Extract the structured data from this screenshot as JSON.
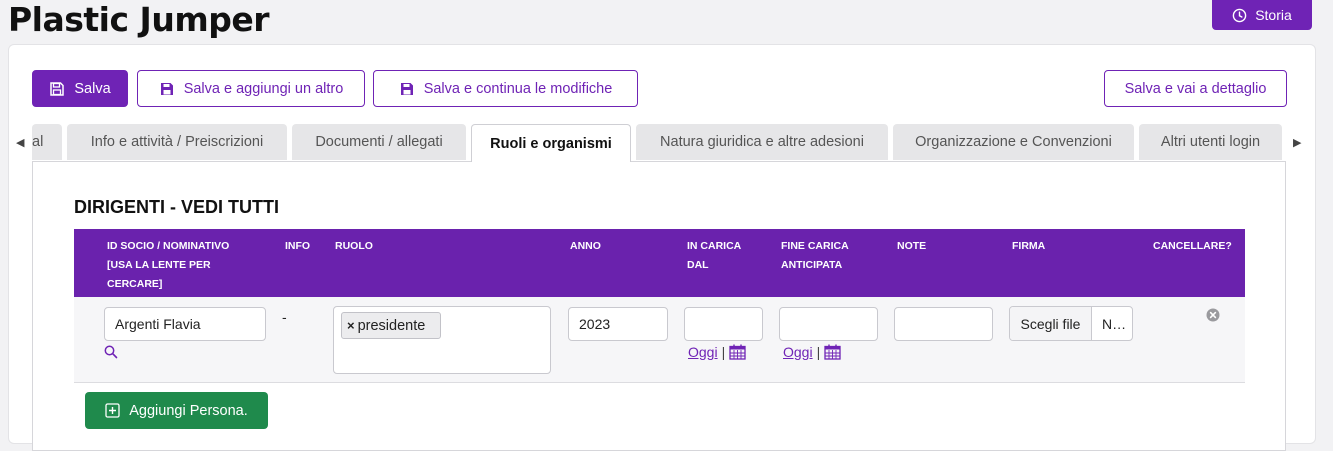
{
  "page": {
    "title": "Plastic Jumper"
  },
  "header": {
    "history_label": "Storia"
  },
  "toolbar": {
    "save_label": "Salva",
    "save_add_label": "Salva e aggiungi un altro",
    "save_continue_label": "Salva e continua le modifiche",
    "save_detail_label": "Salva e vai a dettaglio"
  },
  "tabs": [
    {
      "label": "al"
    },
    {
      "label": "Info e attività / Preiscrizioni"
    },
    {
      "label": "Documenti / allegati"
    },
    {
      "label": "Ruoli e organismi",
      "active": true
    },
    {
      "label": "Natura giuridica e altre adesioni"
    },
    {
      "label": "Organizzazione e Convenzioni"
    },
    {
      "label": "Altri utenti login"
    }
  ],
  "section": {
    "title": "DIRIGENTI - VEDI TUTTI"
  },
  "table": {
    "headers": {
      "id_socio": "ID SOCIO / NOMINATIVO\n[USA LA LENTE PER\nCERCARE]",
      "info": "INFO",
      "ruolo": "RUOLO",
      "anno": "ANNO",
      "in_carica": "IN CARICA\nDAL",
      "fine_carica": "FINE CARICA\nANTICIPATA",
      "note": "NOTE",
      "firma": "FIRMA",
      "cancellare": "CANCELLARE?"
    },
    "rows": [
      {
        "nominativo": "Argenti Flavia",
        "info": "-",
        "ruolo_chip": "presidente",
        "chip_remove": "×",
        "anno": "2023",
        "in_carica_link": "Oggi",
        "fine_carica_link": "Oggi",
        "separator": "|",
        "file_button": "Scegli file",
        "file_name": "N…"
      }
    ]
  },
  "add_person_label": "Aggiungi Persona.",
  "colors": {
    "primary": "#6f23b5",
    "header": "#6a22ad",
    "success": "#1f8a4c"
  }
}
